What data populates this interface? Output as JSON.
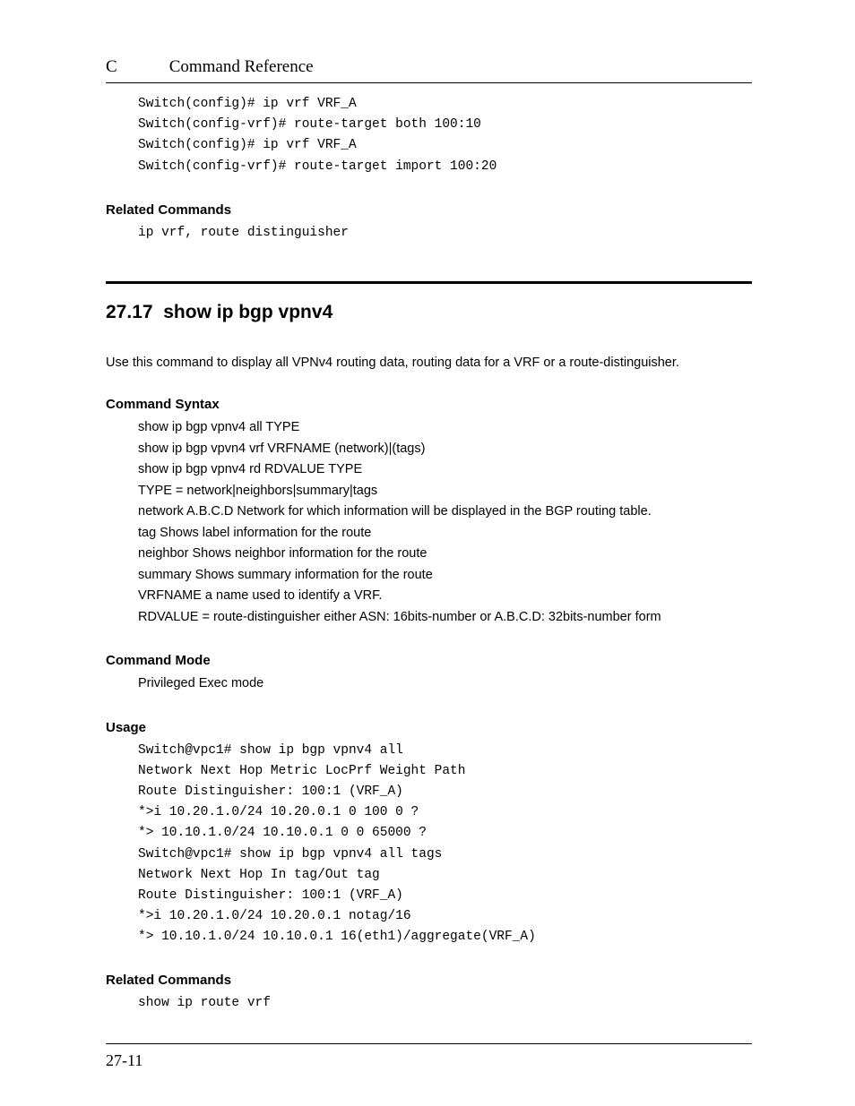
{
  "header": {
    "letter": "C",
    "title": "Command Reference"
  },
  "topCode": "Switch(config)# ip vrf VRF_A\nSwitch(config-vrf)# route-target both 100:10\nSwitch(config)# ip vrf VRF_A\nSwitch(config-vrf)# route-target import 100:20",
  "related1": {
    "label": "Related Commands",
    "code": "ip vrf, route distinguisher"
  },
  "section": {
    "number": "27.17",
    "title": "show ip bgp vpnv4",
    "intro": "Use this command to display all VPNv4 routing data, routing data for a VRF or a route-distinguisher."
  },
  "syntax": {
    "label": "Command Syntax",
    "lines": [
      "show ip bgp vpnv4 all TYPE",
      "show ip bgp vpvn4 vrf VRFNAME (network)|(tags)",
      "show ip bgp vpnv4 rd RDVALUE TYPE",
      "TYPE = network|neighbors|summary|tags",
      "network A.B.C.D Network for which information will be displayed in the BGP routing table.",
      "tag Shows label information for the route",
      "neighbor Shows neighbor information for the route",
      "summary Shows summary information for the route",
      "VRFNAME a name used to identify a VRF.",
      "RDVALUE = route-distinguisher either ASN: 16bits-number or A.B.C.D: 32bits-number form"
    ]
  },
  "mode": {
    "label": "Command Mode",
    "text": "Privileged Exec mode"
  },
  "usage": {
    "label": "Usage",
    "code": "Switch@vpc1# show ip bgp vpnv4 all\nNetwork Next Hop Metric LocPrf Weight Path\nRoute Distinguisher: 100:1 (VRF_A)\n*>i 10.20.1.0/24 10.20.0.1 0 100 0 ?\n*> 10.10.1.0/24 10.10.0.1 0 0 65000 ?\nSwitch@vpc1# show ip bgp vpnv4 all tags\nNetwork Next Hop In tag/Out tag\nRoute Distinguisher: 100:1 (VRF_A)\n*>i 10.20.1.0/24 10.20.0.1 notag/16\n*> 10.10.1.0/24 10.10.0.1 16(eth1)/aggregate(VRF_A)"
  },
  "related2": {
    "label": "Related Commands",
    "code": "show ip route vrf"
  },
  "footer": {
    "page": "27-11"
  }
}
